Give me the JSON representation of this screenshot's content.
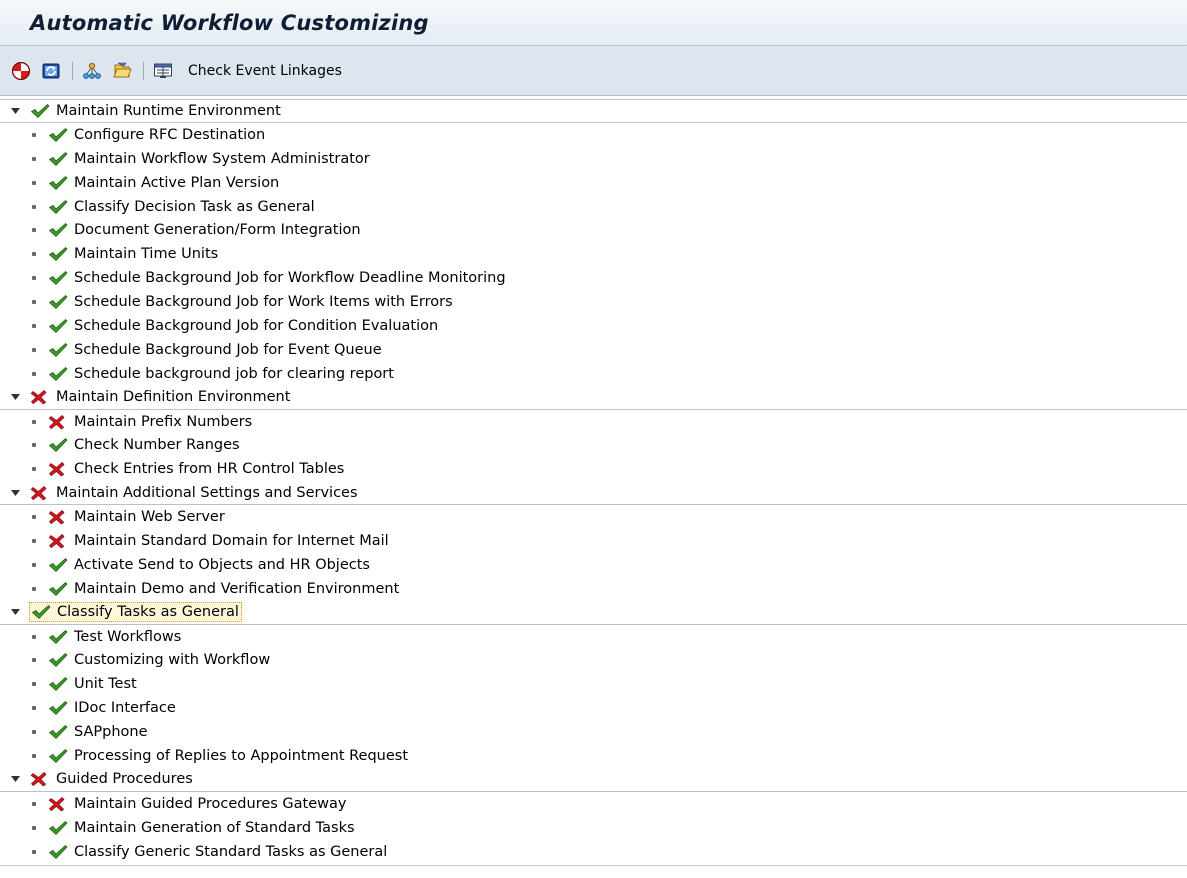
{
  "window": {
    "title": "Automatic Workflow Customizing"
  },
  "toolbar": {
    "buttons": [
      {
        "name": "perform-automatic-customizing",
        "icon": "red-dot-icon"
      },
      {
        "name": "refresh",
        "icon": "refresh-icon"
      },
      {
        "name": "expand-all",
        "icon": "tree-nodes-icon"
      },
      {
        "name": "perform-activity",
        "icon": "execute-icon"
      }
    ],
    "check_event_linkages_label": "Check Event Linkages"
  },
  "colors": {
    "ok": "#3a9a26",
    "error": "#d4161e",
    "title_bg": "#eef3f8",
    "toolbar_bg": "#dde6ef"
  },
  "tree": [
    {
      "label": "Maintain Runtime Environment",
      "status": "ok",
      "selected": false,
      "children": [
        {
          "label": "Configure RFC Destination",
          "status": "ok"
        },
        {
          "label": "Maintain Workflow System Administrator",
          "status": "ok"
        },
        {
          "label": "Maintain Active Plan Version",
          "status": "ok"
        },
        {
          "label": "Classify Decision Task as General",
          "status": "ok"
        },
        {
          "label": "Document Generation/Form Integration",
          "status": "ok"
        },
        {
          "label": "Maintain Time Units",
          "status": "ok"
        },
        {
          "label": "Schedule Background Job for Workflow Deadline Monitoring",
          "status": "ok"
        },
        {
          "label": "Schedule Background Job for Work Items with Errors",
          "status": "ok"
        },
        {
          "label": "Schedule Background Job for Condition Evaluation",
          "status": "ok"
        },
        {
          "label": "Schedule Background Job for Event Queue",
          "status": "ok"
        },
        {
          "label": "Schedule background job for clearing report",
          "status": "ok"
        }
      ]
    },
    {
      "label": "Maintain Definition Environment",
      "status": "error",
      "selected": false,
      "children": [
        {
          "label": "Maintain Prefix Numbers",
          "status": "error"
        },
        {
          "label": "Check Number Ranges",
          "status": "ok"
        },
        {
          "label": "Check Entries from HR Control Tables",
          "status": "error"
        }
      ]
    },
    {
      "label": "Maintain Additional Settings and Services",
      "status": "error",
      "selected": false,
      "children": [
        {
          "label": "Maintain Web Server",
          "status": "error"
        },
        {
          "label": "Maintain Standard Domain for Internet Mail",
          "status": "error"
        },
        {
          "label": "Activate Send to Objects and HR Objects",
          "status": "ok"
        },
        {
          "label": "Maintain Demo and Verification Environment",
          "status": "ok"
        }
      ]
    },
    {
      "label": "Classify Tasks as General",
      "status": "ok",
      "selected": true,
      "children": [
        {
          "label": "Test Workflows",
          "status": "ok"
        },
        {
          "label": "Customizing with Workflow",
          "status": "ok"
        },
        {
          "label": "Unit Test",
          "status": "ok"
        },
        {
          "label": "IDoc Interface",
          "status": "ok"
        },
        {
          "label": "SAPphone",
          "status": "ok"
        },
        {
          "label": "Processing of Replies to Appointment Request",
          "status": "ok"
        }
      ]
    },
    {
      "label": "Guided Procedures",
      "status": "error",
      "selected": false,
      "children": [
        {
          "label": "Maintain Guided Procedures Gateway",
          "status": "error"
        },
        {
          "label": "Maintain Generation of Standard Tasks",
          "status": "ok"
        },
        {
          "label": "Classify Generic Standard Tasks as General",
          "status": "ok"
        }
      ]
    }
  ]
}
